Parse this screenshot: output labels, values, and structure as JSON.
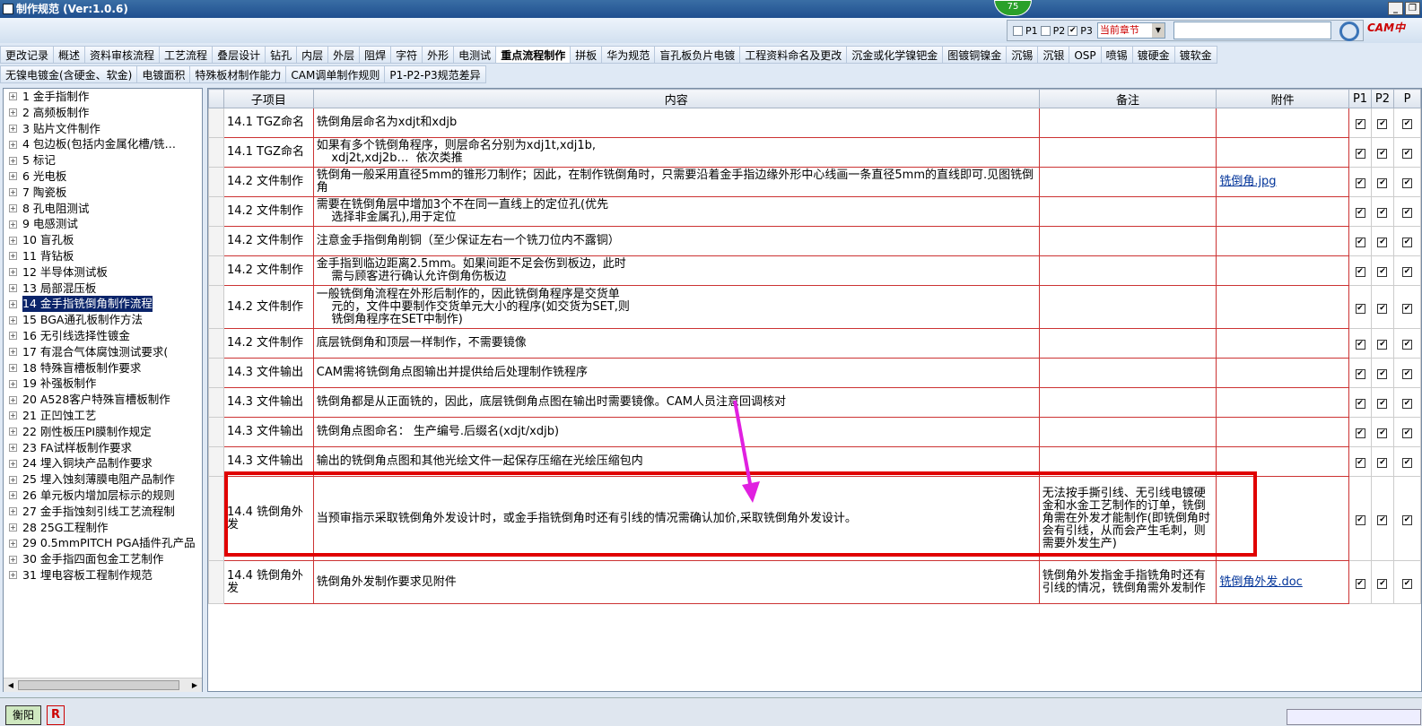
{
  "window": {
    "title": "制作规范 (Ver:1.0.6)",
    "badge": "75"
  },
  "filter": {
    "p1": "P1",
    "p2": "P2",
    "p3": "P3",
    "scope": "当前章节",
    "logo": "CAM中"
  },
  "tabs_row1": [
    "更改记录",
    "概述",
    "资料审核流程",
    "工艺流程",
    "叠层设计",
    "钻孔",
    "内层",
    "外层",
    "阻焊",
    "字符",
    "外形",
    "电测试",
    "重点流程制作",
    "拼板",
    "华为规范",
    "盲孔板负片电镀",
    "工程资料命名及更改",
    "沉金或化学镍钯金",
    "图镀铜镍金",
    "沉锡",
    "沉银",
    "OSP",
    "喷锡",
    "镀硬金",
    "镀软金"
  ],
  "active_tab": "重点流程制作",
  "tabs_row2": [
    "无镍电镀金(含硬金、软金)",
    "电镀面积",
    "特殊板材制作能力",
    "CAM调单制作规则",
    "P1-P2-P3规范差异"
  ],
  "tree": [
    "1  金手指制作",
    "2  高频板制作",
    "3  贴片文件制作",
    "4  包边板(包括内金属化槽/铣…",
    "5  标记",
    "6  光电板",
    "7  陶瓷板",
    "8  孔电阻测试",
    "9  电感测试",
    "10  盲孔板",
    "11  背钻板",
    "12  半导体测试板",
    "13  局部混压板",
    "14  金手指铣倒角制作流程",
    "15  BGA通孔板制作方法",
    "16  无引线选择性镀金",
    "17  有混合气体腐蚀测试要求(",
    "18  特殊盲槽板制作要求",
    "19  补强板制作",
    "20  A528客户特殊盲槽板制作",
    "21  正凹蚀工艺",
    "22  刚性板压PI膜制作规定",
    "23  FA试样板制作要求",
    "24  埋入铜块产品制作要求",
    "25  埋入蚀刻薄膜电阻产品制作",
    "26  单元板内增加层标示的规则",
    "27  金手指蚀刻引线工艺流程制",
    "28  25G工程制作",
    "29  0.5mmPITCH PGA插件孔产品",
    "30  金手指四面包金工艺制作",
    "31  埋电容板工程制作规范"
  ],
  "tree_selected": 13,
  "table": {
    "headers": [
      "子项目",
      "内容",
      "备注",
      "附件",
      "P1",
      "P2",
      "P"
    ],
    "rows": [
      {
        "sub": "14.1 TGZ命名",
        "content": "铣倒角层命名为xdjt和xdjb",
        "note": "",
        "att": ""
      },
      {
        "sub": "14.1 TGZ命名",
        "content": "如果有多个铣倒角程序，则层命名分别为xdj1t,xdj1b,\n    xdj2t,xdj2b…  依次类推",
        "note": "",
        "att": ""
      },
      {
        "sub": "14.2 文件制作",
        "content": "铣倒角一般采用直径5mm的锥形刀制作；因此，在制作铣倒角时，只需要沿着金手指边缘外形中心线画一条直径5mm的直线即可.见图铣倒角",
        "note": "",
        "att": "铣倒角.jpg"
      },
      {
        "sub": "14.2 文件制作",
        "content": "需要在铣倒角层中增加3个不在同一直线上的定位孔(优先\n    选择非金属孔),用于定位",
        "note": "",
        "att": ""
      },
      {
        "sub": "14.2 文件制作",
        "content": "注意金手指倒角削铜（至少保证左右一个铣刀位内不露铜）",
        "note": "",
        "att": ""
      },
      {
        "sub": "14.2 文件制作",
        "content": "金手指到临边距离2.5mm。如果间距不足会伤到板边，此时\n    需与顾客进行确认允许倒角伤板边",
        "note": "",
        "att": ""
      },
      {
        "sub": "14.2 文件制作",
        "content": "一般铣倒角流程在外形后制作的，因此铣倒角程序是交货单\n    元的，文件中要制作交货单元大小的程序(如交货为SET,则\n    铣倒角程序在SET中制作)",
        "note": "",
        "att": ""
      },
      {
        "sub": "14.2 文件制作",
        "content": "底层铣倒角和顶层一样制作，不需要镜像",
        "note": "",
        "att": ""
      },
      {
        "sub": "14.3 文件输出",
        "content": "CAM需将铣倒角点图输出并提供给后处理制作铣程序",
        "note": "",
        "att": ""
      },
      {
        "sub": "14.3 文件输出",
        "content": "铣倒角都是从正面铣的，因此，底层铣倒角点图在输出时需要镜像。CAM人员注意回调核对",
        "note": "",
        "att": ""
      },
      {
        "sub": "14.3 文件输出",
        "content": "铣倒角点图命名： 生产编号.后缀名(xdjt/xdjb)",
        "note": "",
        "att": ""
      },
      {
        "sub": "14.3 文件输出",
        "content": "输出的铣倒角点图和其他光绘文件一起保存压缩在光绘压缩包内",
        "note": "",
        "att": ""
      },
      {
        "sub": "14.4 铣倒角外发",
        "content": "当预审指示采取铣倒角外发设计时，或金手指铣倒角时还有引线的情况需确认加价,采取铣倒角外发设计。",
        "note": "无法按手撕引线、无引线电镀硬金和水金工艺制作的订单，铣倒角需在外发才能制作(即铣倒角时会有引线，从而会产生毛刺，则需要外发生产)",
        "att": ""
      },
      {
        "sub": "14.4 铣倒角外发",
        "content": "铣倒角外发制作要求见附件",
        "note": "铣倒角外发指金手指铣角时还有引线的情况，铣倒角需外发制作",
        "att": "铣倒角外发.doc"
      }
    ]
  },
  "status": {
    "left1": "衡阳",
    "left2": "R"
  }
}
